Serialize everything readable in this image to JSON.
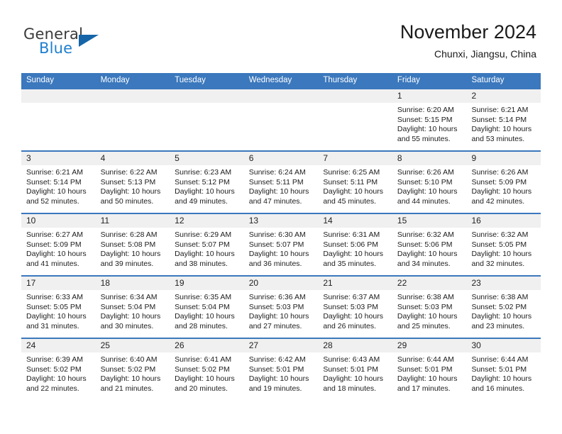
{
  "brand": {
    "name_top": "General",
    "name_bottom": "Blue",
    "triangle_color": "#1565a8",
    "blue_color": "#1f7fd0"
  },
  "header": {
    "title": "November 2024",
    "subtitle": "Chunxi, Jiangsu, China"
  },
  "theme": {
    "header_blue": "#3b78bd",
    "daystrip_gray": "#f0f0f0",
    "text_color": "#1c1c1c"
  },
  "weekdays": [
    "Sunday",
    "Monday",
    "Tuesday",
    "Wednesday",
    "Thursday",
    "Friday",
    "Saturday"
  ],
  "weeks": [
    [
      {
        "day": "",
        "sunrise": "",
        "sunset": "",
        "daylight1": "",
        "daylight2": ""
      },
      {
        "day": "",
        "sunrise": "",
        "sunset": "",
        "daylight1": "",
        "daylight2": ""
      },
      {
        "day": "",
        "sunrise": "",
        "sunset": "",
        "daylight1": "",
        "daylight2": ""
      },
      {
        "day": "",
        "sunrise": "",
        "sunset": "",
        "daylight1": "",
        "daylight2": ""
      },
      {
        "day": "",
        "sunrise": "",
        "sunset": "",
        "daylight1": "",
        "daylight2": ""
      },
      {
        "day": "1",
        "sunrise": "Sunrise: 6:20 AM",
        "sunset": "Sunset: 5:15 PM",
        "daylight1": "Daylight: 10 hours",
        "daylight2": "and 55 minutes."
      },
      {
        "day": "2",
        "sunrise": "Sunrise: 6:21 AM",
        "sunset": "Sunset: 5:14 PM",
        "daylight1": "Daylight: 10 hours",
        "daylight2": "and 53 minutes."
      }
    ],
    [
      {
        "day": "3",
        "sunrise": "Sunrise: 6:21 AM",
        "sunset": "Sunset: 5:14 PM",
        "daylight1": "Daylight: 10 hours",
        "daylight2": "and 52 minutes."
      },
      {
        "day": "4",
        "sunrise": "Sunrise: 6:22 AM",
        "sunset": "Sunset: 5:13 PM",
        "daylight1": "Daylight: 10 hours",
        "daylight2": "and 50 minutes."
      },
      {
        "day": "5",
        "sunrise": "Sunrise: 6:23 AM",
        "sunset": "Sunset: 5:12 PM",
        "daylight1": "Daylight: 10 hours",
        "daylight2": "and 49 minutes."
      },
      {
        "day": "6",
        "sunrise": "Sunrise: 6:24 AM",
        "sunset": "Sunset: 5:11 PM",
        "daylight1": "Daylight: 10 hours",
        "daylight2": "and 47 minutes."
      },
      {
        "day": "7",
        "sunrise": "Sunrise: 6:25 AM",
        "sunset": "Sunset: 5:11 PM",
        "daylight1": "Daylight: 10 hours",
        "daylight2": "and 45 minutes."
      },
      {
        "day": "8",
        "sunrise": "Sunrise: 6:26 AM",
        "sunset": "Sunset: 5:10 PM",
        "daylight1": "Daylight: 10 hours",
        "daylight2": "and 44 minutes."
      },
      {
        "day": "9",
        "sunrise": "Sunrise: 6:26 AM",
        "sunset": "Sunset: 5:09 PM",
        "daylight1": "Daylight: 10 hours",
        "daylight2": "and 42 minutes."
      }
    ],
    [
      {
        "day": "10",
        "sunrise": "Sunrise: 6:27 AM",
        "sunset": "Sunset: 5:09 PM",
        "daylight1": "Daylight: 10 hours",
        "daylight2": "and 41 minutes."
      },
      {
        "day": "11",
        "sunrise": "Sunrise: 6:28 AM",
        "sunset": "Sunset: 5:08 PM",
        "daylight1": "Daylight: 10 hours",
        "daylight2": "and 39 minutes."
      },
      {
        "day": "12",
        "sunrise": "Sunrise: 6:29 AM",
        "sunset": "Sunset: 5:07 PM",
        "daylight1": "Daylight: 10 hours",
        "daylight2": "and 38 minutes."
      },
      {
        "day": "13",
        "sunrise": "Sunrise: 6:30 AM",
        "sunset": "Sunset: 5:07 PM",
        "daylight1": "Daylight: 10 hours",
        "daylight2": "and 36 minutes."
      },
      {
        "day": "14",
        "sunrise": "Sunrise: 6:31 AM",
        "sunset": "Sunset: 5:06 PM",
        "daylight1": "Daylight: 10 hours",
        "daylight2": "and 35 minutes."
      },
      {
        "day": "15",
        "sunrise": "Sunrise: 6:32 AM",
        "sunset": "Sunset: 5:06 PM",
        "daylight1": "Daylight: 10 hours",
        "daylight2": "and 34 minutes."
      },
      {
        "day": "16",
        "sunrise": "Sunrise: 6:32 AM",
        "sunset": "Sunset: 5:05 PM",
        "daylight1": "Daylight: 10 hours",
        "daylight2": "and 32 minutes."
      }
    ],
    [
      {
        "day": "17",
        "sunrise": "Sunrise: 6:33 AM",
        "sunset": "Sunset: 5:05 PM",
        "daylight1": "Daylight: 10 hours",
        "daylight2": "and 31 minutes."
      },
      {
        "day": "18",
        "sunrise": "Sunrise: 6:34 AM",
        "sunset": "Sunset: 5:04 PM",
        "daylight1": "Daylight: 10 hours",
        "daylight2": "and 30 minutes."
      },
      {
        "day": "19",
        "sunrise": "Sunrise: 6:35 AM",
        "sunset": "Sunset: 5:04 PM",
        "daylight1": "Daylight: 10 hours",
        "daylight2": "and 28 minutes."
      },
      {
        "day": "20",
        "sunrise": "Sunrise: 6:36 AM",
        "sunset": "Sunset: 5:03 PM",
        "daylight1": "Daylight: 10 hours",
        "daylight2": "and 27 minutes."
      },
      {
        "day": "21",
        "sunrise": "Sunrise: 6:37 AM",
        "sunset": "Sunset: 5:03 PM",
        "daylight1": "Daylight: 10 hours",
        "daylight2": "and 26 minutes."
      },
      {
        "day": "22",
        "sunrise": "Sunrise: 6:38 AM",
        "sunset": "Sunset: 5:03 PM",
        "daylight1": "Daylight: 10 hours",
        "daylight2": "and 25 minutes."
      },
      {
        "day": "23",
        "sunrise": "Sunrise: 6:38 AM",
        "sunset": "Sunset: 5:02 PM",
        "daylight1": "Daylight: 10 hours",
        "daylight2": "and 23 minutes."
      }
    ],
    [
      {
        "day": "24",
        "sunrise": "Sunrise: 6:39 AM",
        "sunset": "Sunset: 5:02 PM",
        "daylight1": "Daylight: 10 hours",
        "daylight2": "and 22 minutes."
      },
      {
        "day": "25",
        "sunrise": "Sunrise: 6:40 AM",
        "sunset": "Sunset: 5:02 PM",
        "daylight1": "Daylight: 10 hours",
        "daylight2": "and 21 minutes."
      },
      {
        "day": "26",
        "sunrise": "Sunrise: 6:41 AM",
        "sunset": "Sunset: 5:02 PM",
        "daylight1": "Daylight: 10 hours",
        "daylight2": "and 20 minutes."
      },
      {
        "day": "27",
        "sunrise": "Sunrise: 6:42 AM",
        "sunset": "Sunset: 5:01 PM",
        "daylight1": "Daylight: 10 hours",
        "daylight2": "and 19 minutes."
      },
      {
        "day": "28",
        "sunrise": "Sunrise: 6:43 AM",
        "sunset": "Sunset: 5:01 PM",
        "daylight1": "Daylight: 10 hours",
        "daylight2": "and 18 minutes."
      },
      {
        "day": "29",
        "sunrise": "Sunrise: 6:44 AM",
        "sunset": "Sunset: 5:01 PM",
        "daylight1": "Daylight: 10 hours",
        "daylight2": "and 17 minutes."
      },
      {
        "day": "30",
        "sunrise": "Sunrise: 6:44 AM",
        "sunset": "Sunset: 5:01 PM",
        "daylight1": "Daylight: 10 hours",
        "daylight2": "and 16 minutes."
      }
    ]
  ]
}
